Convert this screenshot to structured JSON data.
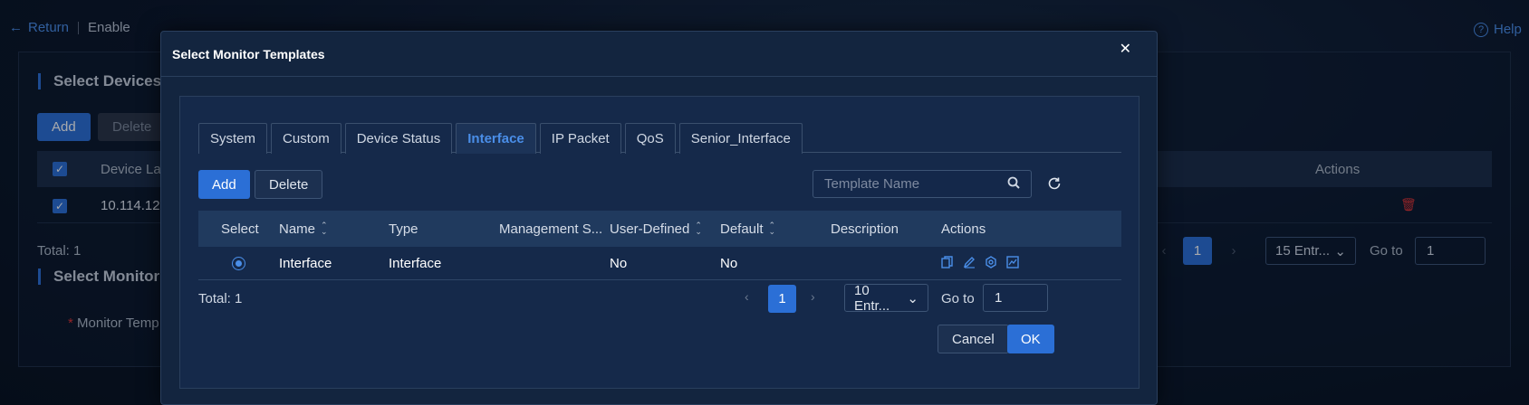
{
  "background": {
    "return_label": "Return",
    "breadcrumb": "Enable",
    "help_label": "Help",
    "section1_title": "Select Devices",
    "add_label": "Add",
    "delete_label": "Delete",
    "col_device": "Device La",
    "col_actions": "Actions",
    "row_device": "10.114.12",
    "total": "Total: 1",
    "page": "1",
    "page_size": "15 Entr...",
    "goto_label": "Go to",
    "goto_value": "1",
    "section2_title": "Select Monitor",
    "monitor_field_label": "Monitor Temp"
  },
  "modal": {
    "title": "Select Monitor Templates",
    "tabs": [
      {
        "label": "System"
      },
      {
        "label": "Custom"
      },
      {
        "label": "Device Status"
      },
      {
        "label": "Interface"
      },
      {
        "label": "IP Packet"
      },
      {
        "label": "QoS"
      },
      {
        "label": "Senior_Interface"
      }
    ],
    "add_label": "Add",
    "delete_label": "Delete",
    "search_placeholder": "Template Name",
    "columns": {
      "select": "Select",
      "name": "Name",
      "type": "Type",
      "management": "Management S...",
      "user_defined": "User-Defined",
      "default": "Default",
      "description": "Description",
      "actions": "Actions"
    },
    "rows": [
      {
        "name": "Interface",
        "type": "Interface",
        "management": "",
        "user_defined": "No",
        "default": "No",
        "description": ""
      }
    ],
    "total": "Total: 1",
    "page": "1",
    "page_size": "10 Entr...",
    "goto_label": "Go to",
    "goto_value": "1",
    "cancel_label": "Cancel",
    "ok_label": "OK"
  },
  "colors": {
    "accent": "#2b6fd6",
    "link": "#4a8ee8",
    "background": "#0b1628",
    "modal": "#13253f"
  }
}
